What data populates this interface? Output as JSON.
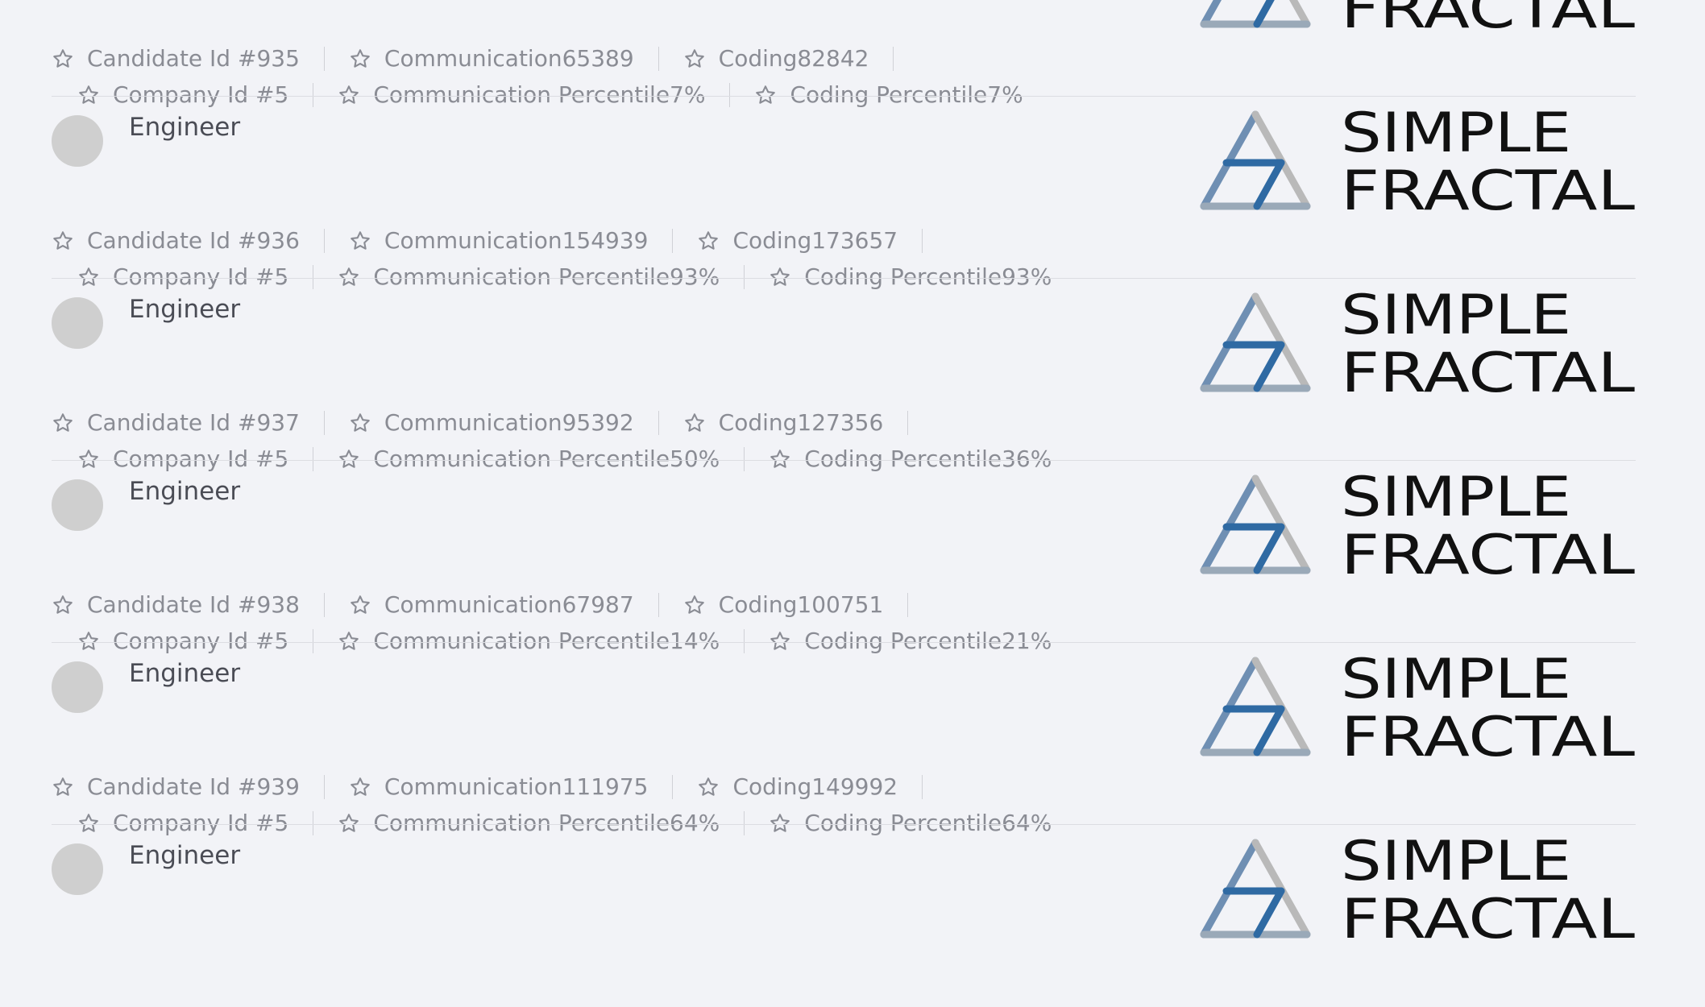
{
  "items": [
    {
      "title": "Engineer",
      "candidate": "Candidate Id #935",
      "communication": "Communication65389",
      "coding": "Coding82842",
      "company": "Company Id #5",
      "comm_percentile": "Communication Percentile7%",
      "coding_percentile": "Coding Percentile7%",
      "logo_text": [
        "SIMPLE",
        "FRACTAL"
      ]
    },
    {
      "title": "Engineer",
      "candidate": "Candidate Id #936",
      "communication": "Communication154939",
      "coding": "Coding173657",
      "company": "Company Id #5",
      "comm_percentile": "Communication Percentile93%",
      "coding_percentile": "Coding Percentile93%",
      "logo_text": [
        "SIMPLE",
        "FRACTAL"
      ]
    },
    {
      "title": "Engineer",
      "candidate": "Candidate Id #937",
      "communication": "Communication95392",
      "coding": "Coding127356",
      "company": "Company Id #5",
      "comm_percentile": "Communication Percentile50%",
      "coding_percentile": "Coding Percentile36%",
      "logo_text": [
        "SIMPLE",
        "FRACTAL"
      ]
    },
    {
      "title": "Engineer",
      "candidate": "Candidate Id #938",
      "communication": "Communication67987",
      "coding": "Coding100751",
      "company": "Company Id #5",
      "comm_percentile": "Communication Percentile14%",
      "coding_percentile": "Coding Percentile21%",
      "logo_text": [
        "SIMPLE",
        "FRACTAL"
      ]
    },
    {
      "title": "Engineer",
      "candidate": "Candidate Id #939",
      "communication": "Communication111975",
      "coding": "Coding149992",
      "company": "Company Id #5",
      "comm_percentile": "Communication Percentile64%",
      "coding_percentile": "Coding Percentile64%",
      "logo_text": [
        "SIMPLE",
        "FRACTAL"
      ]
    },
    {
      "title": "Engineer",
      "logo_text": [
        "SIMPLE",
        "FRACTAL"
      ]
    }
  ],
  "icons": {
    "meta": "star-icon"
  },
  "colors": {
    "background": "#f2f3f7",
    "divider": "#dcdde2",
    "meta_text": "#8a8c94",
    "title_text": "#4a4c55",
    "avatar": "#cfcfcf",
    "logo_blue": "#2f6aa3",
    "logo_grey": "#b9b9b9",
    "logo_text": "#111111"
  }
}
